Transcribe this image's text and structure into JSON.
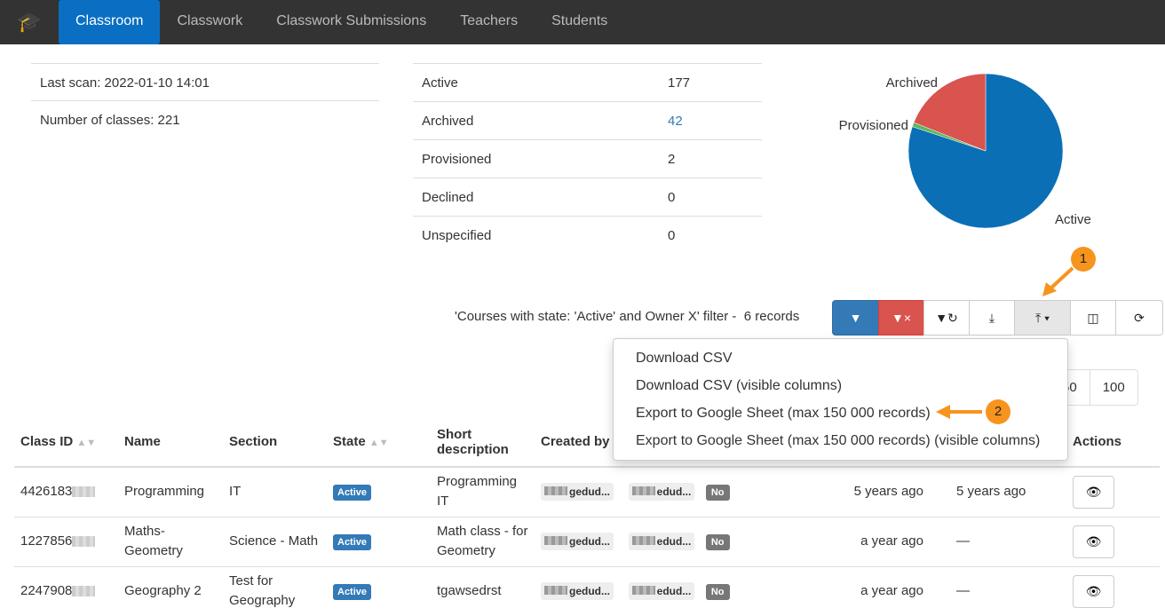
{
  "nav": {
    "logo_icon": "graduation-cap-icon",
    "items": [
      {
        "label": "Classroom",
        "active": true
      },
      {
        "label": "Classwork"
      },
      {
        "label": "Classwork Submissions"
      },
      {
        "label": "Teachers"
      },
      {
        "label": "Students"
      }
    ]
  },
  "info": {
    "last_scan": "Last scan: 2022-01-10 14:01",
    "num_classes": "Number of classes: 221"
  },
  "stats": [
    {
      "label": "Active",
      "value": "177"
    },
    {
      "label": "Archived",
      "value": "42"
    },
    {
      "label": "Provisioned",
      "value": "2"
    },
    {
      "label": "Declined",
      "value": "0"
    },
    {
      "label": "Unspecified",
      "value": "0"
    }
  ],
  "chart_data": {
    "type": "pie",
    "slices": [
      {
        "label": "Active",
        "value": 177,
        "color": "#0a6fb5"
      },
      {
        "label": "Provisioned",
        "value": 2,
        "color": "#5cb85c"
      },
      {
        "label": "Archived",
        "value": 42,
        "color": "#d9534f"
      }
    ]
  },
  "filter": {
    "text": "'Courses with state: 'Active' and Owner X' filter -",
    "records": "6 records"
  },
  "toolbar": [
    "filter-icon",
    "clear-filter-icon",
    "reset-filter-icon",
    "import-icon",
    "export-icon",
    "columns-icon",
    "refresh-icon"
  ],
  "export_menu": [
    "Download CSV",
    "Download CSV (visible columns)",
    "Export to Google Sheet (max 150 000 records)",
    "Export to Google Sheet (max 150 000 records) (visible columns)"
  ],
  "pager": [
    "50",
    "100"
  ],
  "callouts": [
    "1",
    "2"
  ],
  "table": {
    "headers": [
      "Class ID",
      "Name",
      "Section",
      "State",
      "Short description",
      "Created by",
      "",
      "",
      "",
      "",
      "",
      "Actions"
    ],
    "rows": [
      {
        "id": "4426183",
        "name": "Programming",
        "section": "IT",
        "state": "Active",
        "desc": "Programming IT",
        "owner": "gedud...",
        "teacher": "edud...",
        "flag": "No",
        "created": "5 years ago",
        "updated": "5 years ago"
      },
      {
        "id": "1227856",
        "name": "Maths-Geometry",
        "section": "Science - Math",
        "state": "Active",
        "desc": "Math class - for Geometry",
        "owner": "gedud...",
        "teacher": "edud...",
        "flag": "No",
        "created": "a year ago",
        "updated": "—"
      },
      {
        "id": "2247908",
        "name": "Geography 2",
        "section": "Test for Geography",
        "state": "Active",
        "desc": "tgawsedrst",
        "owner": "gedud...",
        "teacher": "edud...",
        "flag": "No",
        "created": "a year ago",
        "updated": "—"
      }
    ]
  }
}
